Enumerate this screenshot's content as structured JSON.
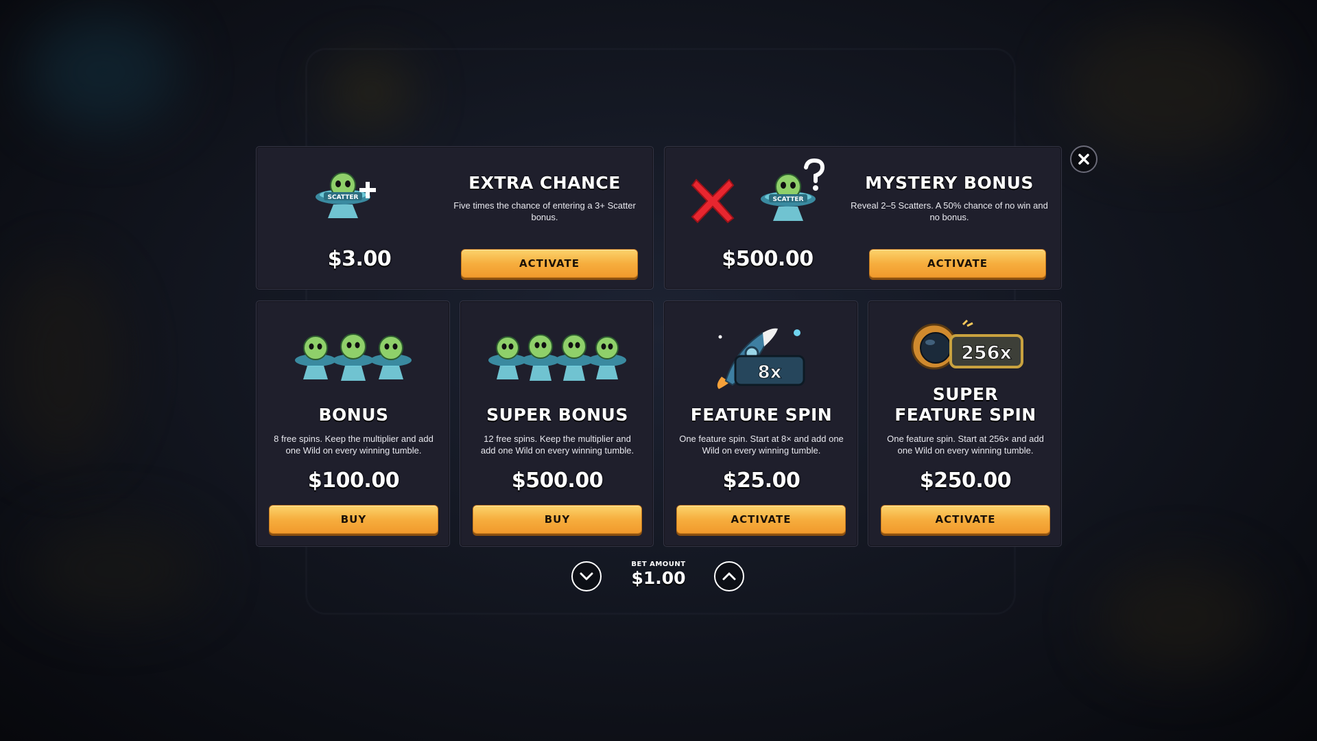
{
  "bet": {
    "label": "BET AMOUNT",
    "value": "$1.00"
  },
  "options": [
    {
      "title": "EXTRA CHANCE",
      "description": "Five times the chance of entering a 3+ Scatter bonus.",
      "price": "$3.00",
      "button": "ACTIVATE",
      "icon": "alien-scatter-plus-icon"
    },
    {
      "title": "MYSTERY BONUS",
      "description": "Reveal 2–5 Scatters. A 50% chance of no win and no bonus.",
      "price": "$500.00",
      "button": "ACTIVATE",
      "icon": "alien-scatter-mystery-icon"
    },
    {
      "title": "BONUS",
      "description": "8 free spins. Keep the multiplier and add one Wild on every winning tumble.",
      "price": "$100.00",
      "button": "BUY",
      "icon": "three-scatters-icon"
    },
    {
      "title": "SUPER BONUS",
      "description": "12 free spins. Keep the multiplier and add one Wild on every winning tumble.",
      "price": "$500.00",
      "button": "BUY",
      "icon": "four-scatters-icon"
    },
    {
      "title": "FEATURE SPIN",
      "description": "One feature spin. Start at 8× and add one Wild on every winning tumble.",
      "price": "$25.00",
      "button": "ACTIVATE",
      "icon": "rocket-8x-icon",
      "badge": "8x"
    },
    {
      "title": "SUPER FEATURE SPIN",
      "description": "One feature spin. Start at 256× and add one Wild on every winning tumble.",
      "price": "$250.00",
      "button": "ACTIVATE",
      "icon": "astronaut-256x-icon",
      "badge": "256x"
    }
  ],
  "scatter_label": "SCATTER",
  "colors": {
    "button_top": "#fbd36c",
    "button_bottom": "#f19a2c",
    "card_bg": "#1f1f2c",
    "close_x": "#ffffff",
    "mystery_x": "#e8262f"
  }
}
